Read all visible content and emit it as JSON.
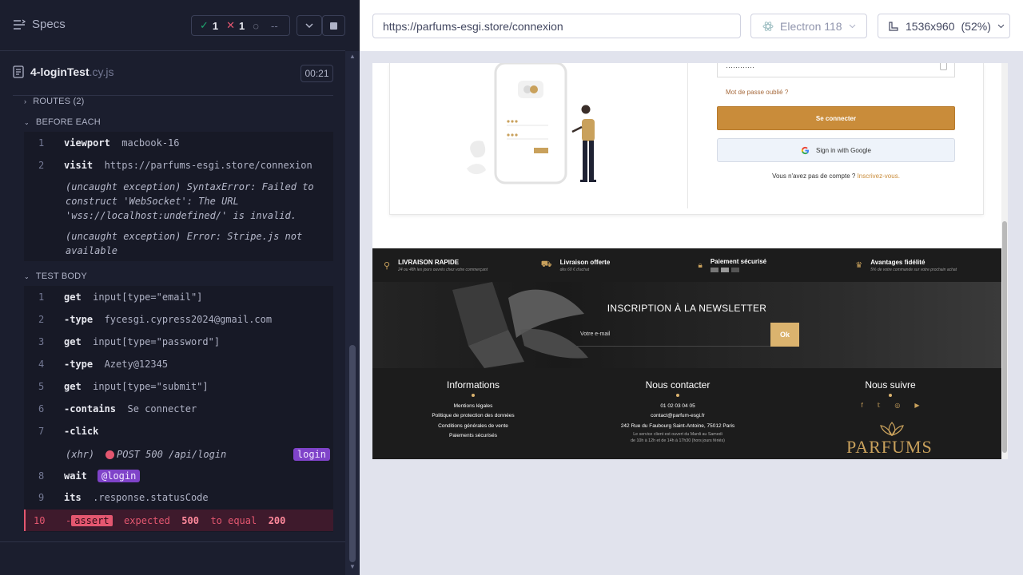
{
  "runner": {
    "specs_label": "Specs",
    "stats": {
      "passed": "1",
      "failed": "1",
      "pending": "--"
    },
    "spec": {
      "name": "4-loginTest",
      "ext": ".cy.js",
      "duration": "00:21"
    },
    "routes_label": "ROUTES (2)",
    "before_each_label": "BEFORE EACH",
    "before_each": [
      {
        "num": "1",
        "name": "viewport",
        "arg": "macbook-16"
      },
      {
        "num": "2",
        "name": "visit",
        "arg": "https://parfums-esgi.store/connexion"
      }
    ],
    "exceptions": [
      "(uncaught exception)  SyntaxError: Failed to construct 'WebSocket': The URL 'wss://localhost:undefined/' is invalid.",
      "(uncaught exception)  Error: Stripe.js not available"
    ],
    "test_body_label": "TEST BODY",
    "test_body": [
      {
        "num": "1",
        "name": "get",
        "arg": "input[type=\"email\"]"
      },
      {
        "num": "2",
        "name": "-type",
        "arg": "fycesgi.cypress2024@gmail.com"
      },
      {
        "num": "3",
        "name": "get",
        "arg": "input[type=\"password\"]"
      },
      {
        "num": "4",
        "name": "-type",
        "arg": "Azety@12345"
      },
      {
        "num": "5",
        "name": "get",
        "arg": "input[type=\"submit\"]"
      },
      {
        "num": "6",
        "name": "-contains",
        "arg": "Se connecter"
      },
      {
        "num": "7",
        "name": "-click",
        "arg": ""
      }
    ],
    "xhr": {
      "prefix": "(xhr)",
      "text": "POST 500 /api/login",
      "alias": "login"
    },
    "wait": {
      "num": "8",
      "name": "wait",
      "alias": "@login"
    },
    "its": {
      "num": "9",
      "name": "its",
      "arg": ".response.statusCode"
    },
    "assert": {
      "num": "10",
      "prefix": "-",
      "label": "assert",
      "expected": "expected",
      "v1": "500",
      "to_equal": "to equal",
      "v2": "200"
    }
  },
  "aut": {
    "url": "https://parfums-esgi.store/connexion",
    "browser": "Electron 118",
    "viewport": "1536x960",
    "scale": "(52%)",
    "login": {
      "password_mask": "············",
      "forgot": "Mot de passe oublié ?",
      "submit": "Se connecter",
      "google": "Sign in with Google",
      "no_account": "Vous n'avez pas de compte ?",
      "signup": "Inscrivez-vous."
    },
    "features": [
      {
        "title": "LIVRAISON RAPIDE",
        "sub": "24 ou 48h les jours ouvrés chez votre commerçant",
        "icon": "delivery-icon"
      },
      {
        "title": "Livraison offerte",
        "sub": "dès 60 € d'achat",
        "icon": "truck-icon"
      },
      {
        "title": "Paiement sécurisé",
        "sub": "",
        "icon": "lock-icon"
      },
      {
        "title": "Avantages fidélité",
        "sub": "5% de votre commande sur votre prochain achat",
        "icon": "crown-icon"
      }
    ],
    "newsletter": {
      "title": "INSCRIPTION À LA NEWSLETTER",
      "placeholder": "Votre e-mail",
      "button": "Ok"
    },
    "footer": {
      "info_title": "Informations",
      "info_links": [
        "Mentions légales",
        "Politique de protection des données",
        "Conditions générales de vente",
        "Paiements sécurisés"
      ],
      "contact_title": "Nous contacter",
      "phone": "01 02 03 04 05",
      "email": "contact@parfum-esgi.fr",
      "address": "242 Rue du Faubourg Saint-Antoine, 75012 Paris",
      "hours1": "Le service client est ouvert du Mardi au Samedi",
      "hours2": "de 10h à 12h et de 14h à 17h30 (hors jours fériés)",
      "follow_title": "Nous suivre",
      "brand": "PARFUMS"
    }
  },
  "colors": {
    "accent": "#c98c3a",
    "fail": "#e45770",
    "alias": "#7f43c9"
  }
}
